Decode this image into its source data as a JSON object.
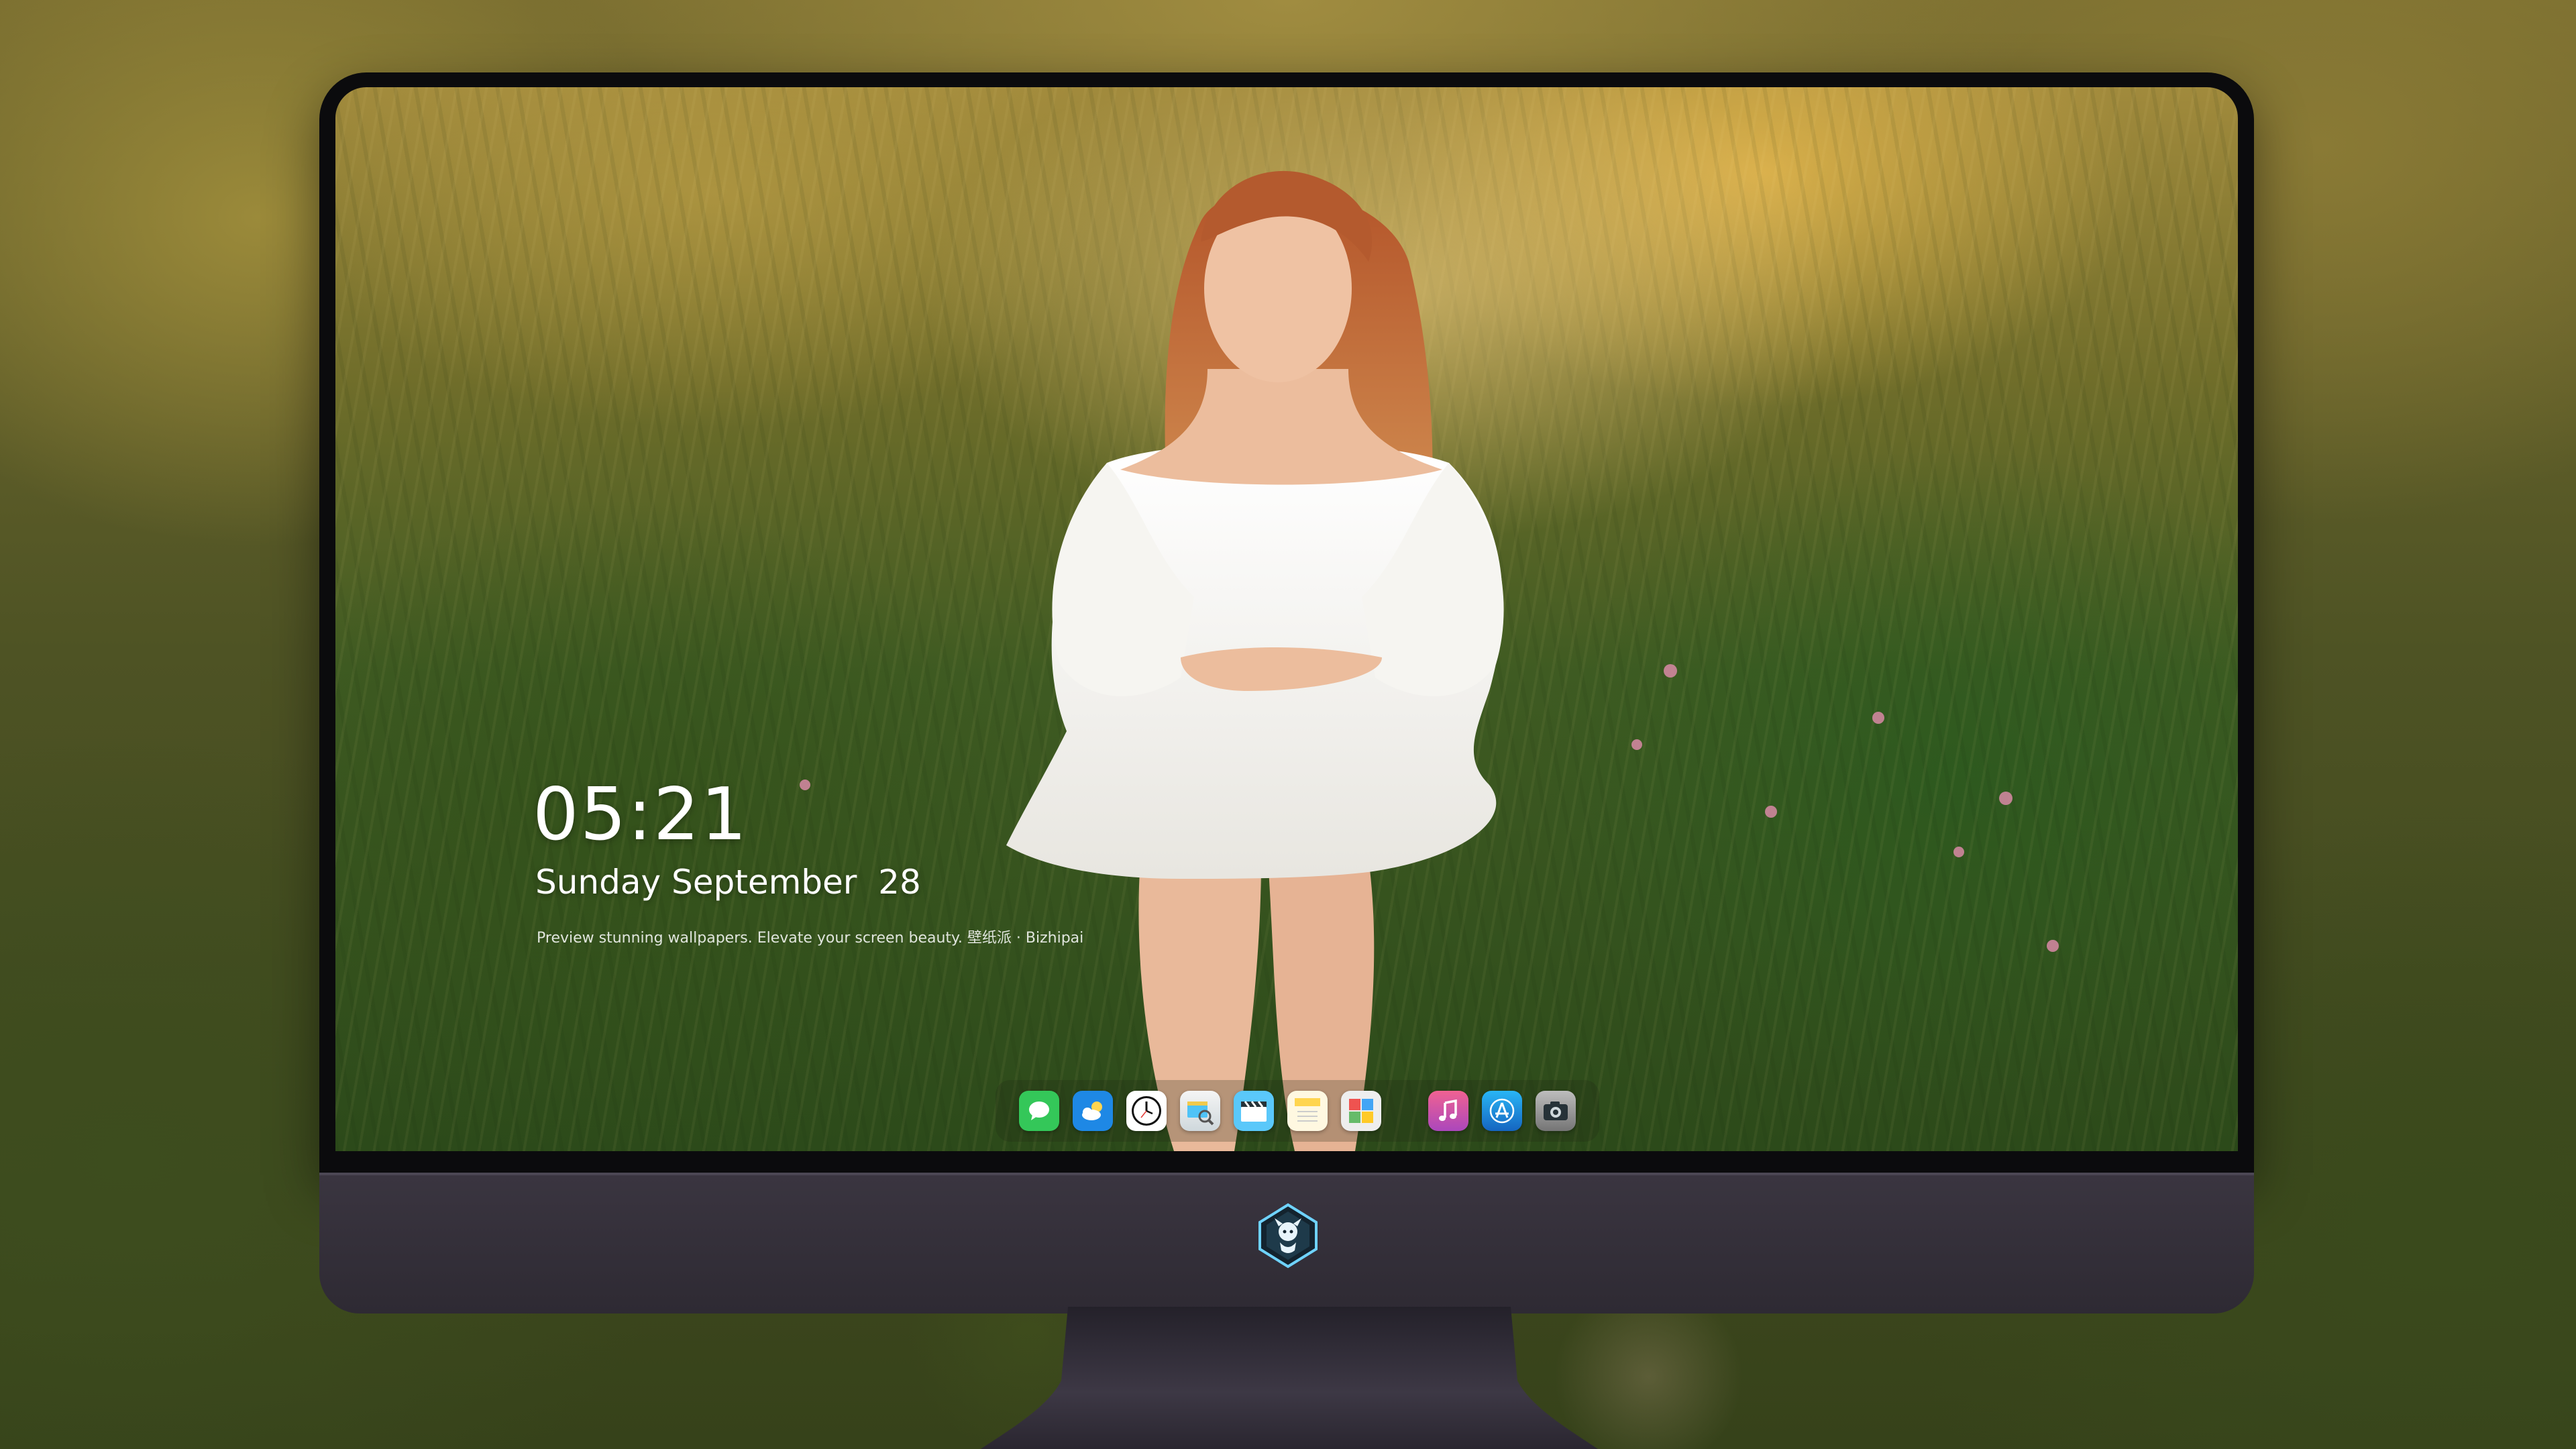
{
  "lockscreen": {
    "time": "05:21",
    "date": "Sunday September  28",
    "tagline": "Preview stunning wallpapers. Elevate your screen beauty. 壁纸派 · Bizhipai"
  },
  "dock": {
    "items": [
      {
        "name": "messages",
        "icon": "message-bubble-icon",
        "color": "#34c759"
      },
      {
        "name": "weather",
        "icon": "cloud-sun-icon",
        "color": "#1e88e5"
      },
      {
        "name": "clock",
        "icon": "clock-icon",
        "color": "#ffffff"
      },
      {
        "name": "preview",
        "icon": "preview-icon",
        "color": "#f2c94c"
      },
      {
        "name": "video",
        "icon": "clapperboard-icon",
        "color": "#5ac8fa"
      },
      {
        "name": "notes",
        "icon": "notes-icon",
        "color": "#ffd54f"
      },
      {
        "name": "photos",
        "icon": "photo-grid-icon",
        "color": "#e0e0e0"
      },
      {
        "name": "music",
        "icon": "music-note-icon",
        "color": "#e040fb"
      },
      {
        "name": "app-store",
        "icon": "app-store-icon",
        "color": "#1e88e5"
      },
      {
        "name": "camera",
        "icon": "camera-icon",
        "color": "#9e9e9e"
      }
    ]
  },
  "colors": {
    "bezel": "#0b0b0d",
    "chin": "#3a3540",
    "stand": "#2f2b33"
  }
}
